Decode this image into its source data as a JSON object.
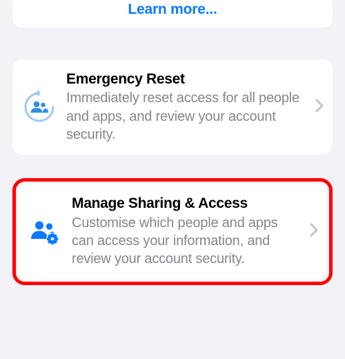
{
  "learnMore": {
    "label": "Learn more..."
  },
  "emergencyReset": {
    "title": "Emergency Reset",
    "desc": "Immediately reset access for all people and apps, and review your account security."
  },
  "manageSharing": {
    "title": "Manage Sharing & Access",
    "desc": "Customise which people and apps can access your information, and review your account security."
  }
}
